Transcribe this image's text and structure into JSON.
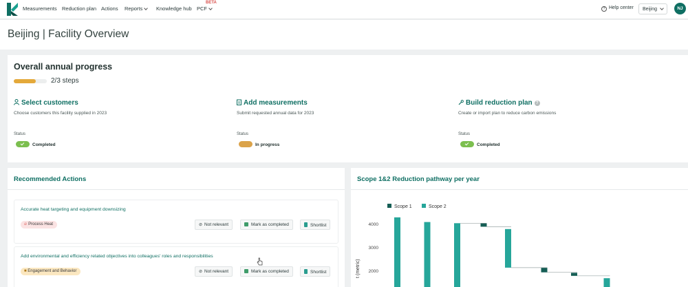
{
  "nav": {
    "items": [
      "Measurements",
      "Reduction plan",
      "Actions",
      "Reports",
      "Knowledge hub",
      "PCF"
    ],
    "beta": "BETA",
    "help": "Help center",
    "facility": "Beijing",
    "avatar": "NJ"
  },
  "header": {
    "title": "Beijing | Facility Overview"
  },
  "progress": {
    "heading": "Overall annual progress",
    "fraction": 0.67,
    "steps_text": "2/3 steps",
    "steps": [
      {
        "title": "Select customers",
        "desc": "Choose customers this facility supplied in 2023",
        "status_label": "Status",
        "status": "Completed",
        "icon": "user-icon"
      },
      {
        "title": "Add measurements",
        "desc": "Submit requested annual data for 2023",
        "status_label": "Status",
        "status": "In progress",
        "icon": "clipboard-icon"
      },
      {
        "title": "Build reduction plan",
        "desc": "Create or import plan to reduce carbon emissions",
        "status_label": "Status",
        "status": "Completed",
        "icon": "wrench-icon"
      }
    ]
  },
  "actions": {
    "heading": "Recommended Actions",
    "items": [
      {
        "title": "Accurate heat targeting and equipment downsizing",
        "tag": "Process Heat"
      },
      {
        "title": "Add environmental and efficiency related objectives into colleagues' roles and responsibilities",
        "tag": "Engagement and Behavior"
      }
    ],
    "buttons": {
      "not_relevant": "Not relevant",
      "mark_completed": "Mark as completed",
      "shortlist": "Shortlist"
    }
  },
  "chart_panel": {
    "heading": "Scope 1&2 Reduction pathway per year"
  },
  "chart_data": {
    "type": "bar",
    "ylabel": "t (metric)",
    "yticks": [
      2000,
      3000,
      4000
    ],
    "series": [
      {
        "name": "Scope 1",
        "color": "#155e55"
      },
      {
        "name": "Scope 2",
        "color": "#26a69a"
      }
    ],
    "bars": [
      {
        "series": "Scope 2",
        "base": 0,
        "top": 4300
      },
      {
        "series": "Scope 2",
        "base": 0,
        "top": 4100
      },
      {
        "series": "Scope 2",
        "base": 0,
        "top": 4050
      },
      {
        "series": "Scope 1",
        "base": 3900,
        "top": 4050
      },
      {
        "series": "Scope 2",
        "base": 2150,
        "top": 3800
      },
      {
        "series": "Scope 1",
        "base": 1950,
        "top": 2150
      },
      {
        "series": "Scope 1",
        "base": 1800,
        "top": 1930
      },
      {
        "series": "Scope 2",
        "base": 0,
        "top": 1700
      }
    ],
    "connectors": [
      4050,
      3900,
      2150,
      1950,
      1800
    ]
  },
  "colors": {
    "brand": "#0f6f63",
    "accent": "#e4a93a",
    "completed": "#7cbf4f",
    "in_progress": "#dba34a"
  }
}
